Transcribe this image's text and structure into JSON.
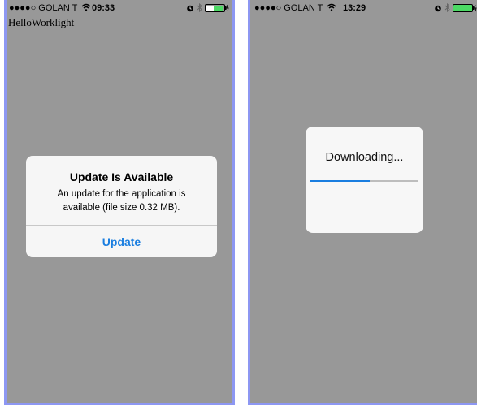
{
  "screens": [
    {
      "status_bar": {
        "signal": "●●●●○",
        "carrier": "GOLAN T",
        "time": "09:33"
      },
      "app_title": "HelloWorklight",
      "alert": {
        "title": "Update Is Available",
        "message": "An update for the application is available (file size 0.32 MB).",
        "button_label": "Update"
      }
    },
    {
      "status_bar": {
        "signal": "●●●●○",
        "carrier": "GOLAN T",
        "time": "13:29"
      },
      "download": {
        "label": "Downloading...",
        "progress": 0.55
      }
    }
  ],
  "colors": {
    "background": "#989898",
    "screen_border": "#8d97f2",
    "accent": "#1a7ee0",
    "battery_left": "#ffffff",
    "battery_right": "#4cd964"
  }
}
